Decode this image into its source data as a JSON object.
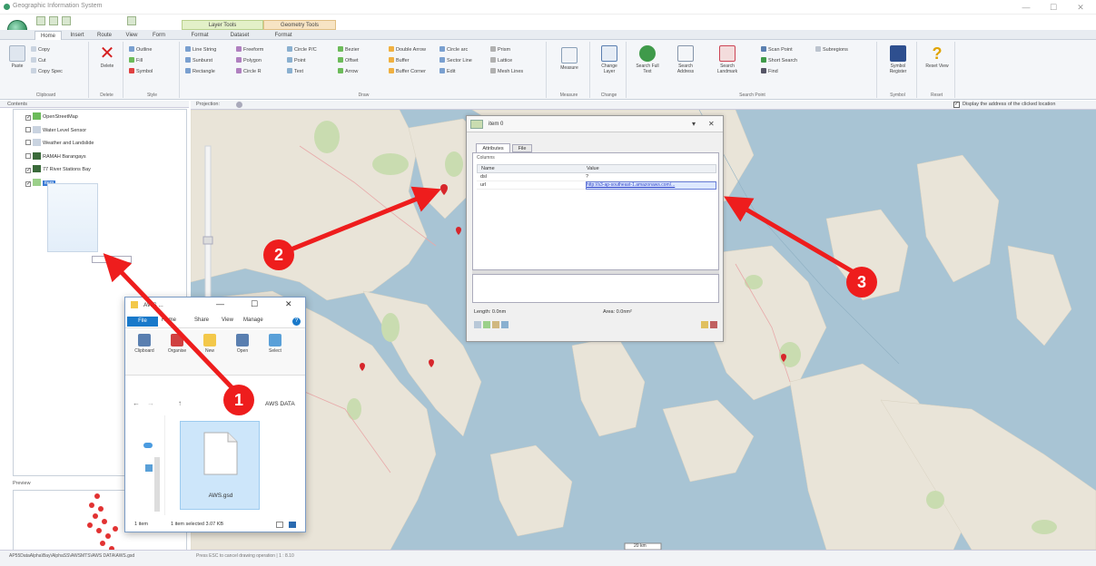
{
  "window": {
    "title": "Geographic Information System",
    "minimize_glyph": "—",
    "maximize_glyph": "☐",
    "close_glyph": "✕"
  },
  "context_tabs": [
    "Layer Tools",
    "Geometry Tools"
  ],
  "tabs": [
    "Home",
    "Insert",
    "Route",
    "View",
    "Form",
    "Format",
    "Dataset",
    "Format"
  ],
  "ribbon": {
    "clipboard": {
      "label": "Clipboard",
      "paste": "Paste",
      "copy": "Copy",
      "cut": "Cut",
      "copy_special": "Copy Spec"
    },
    "delete": {
      "label": "Delete",
      "button": "Delete"
    },
    "style": {
      "label": "Style",
      "outline": "Outline",
      "fill": "Fill",
      "symbol": "Symbol"
    },
    "draw": {
      "label": "Draw",
      "items": [
        "Line String",
        "Freeform",
        "Circle P/C",
        "Bezier",
        "Double Arrow",
        "Circle arc",
        "Prism",
        "Sunburst",
        "Polygon",
        "Point",
        "Offset",
        "Buffer",
        "Sector Line",
        "Lattice",
        "Rectangle",
        "Circle R",
        "Text",
        "Arrow",
        "Buffer Corner",
        "Edit",
        "Mesh Lines"
      ]
    },
    "measure": {
      "label": "Measure",
      "button": "Measure"
    },
    "change": {
      "label": "Change",
      "button": "Change Layer"
    },
    "search": {
      "label": "Search Point",
      "buttons": [
        "Search Full Text",
        "Search Address",
        "Search Landmark"
      ],
      "items": [
        "Scan Point",
        "Short Search",
        "Find",
        "Subregions"
      ]
    },
    "symbol": {
      "label": "Symbol",
      "button": "Symbol Register"
    },
    "reset": {
      "label": "Reset",
      "button": "Reset View"
    }
  },
  "contents": {
    "header": "Contents",
    "layers": [
      {
        "name": "OpenStreetMap",
        "checked": true
      },
      {
        "name": "Water Level Sensor",
        "checked": false
      },
      {
        "name": "Weather and Landslide",
        "checked": false
      },
      {
        "name": "RAMAH Barangays",
        "checked": false
      },
      {
        "name": "77 River Stations Bay",
        "checked": true
      },
      {
        "name": "item",
        "checked": true,
        "selected": true
      }
    ]
  },
  "map": {
    "projection_label": "Projection:",
    "address_checkbox": "Display the address of the clicked location",
    "scale_label": "20 km"
  },
  "dialog": {
    "title": "item 0",
    "tabs": [
      "Attributes",
      "File"
    ],
    "section": "Columns",
    "columns": [
      "Name",
      "Value"
    ],
    "rows": [
      {
        "name": "dsl",
        "value": "?"
      },
      {
        "name": "url",
        "value": "http://s3-ap-southeast-1.amazonaws.com/..."
      }
    ],
    "length": "Length: 0.0nm",
    "area": "Area: 0.0nm²"
  },
  "explorer": {
    "title": "AWS ...",
    "file_tab": "File",
    "tabs": [
      "Home",
      "Share",
      "View",
      "Manage"
    ],
    "groups": [
      "Clipboard",
      "Organise",
      "New",
      "Open",
      "Select"
    ],
    "path": "AWS DATA",
    "file_name": "AWS.gsd",
    "status_items": "1 item",
    "status_selected": "1 item selected  3.07 KB"
  },
  "callouts": [
    "1",
    "2",
    "3"
  ],
  "statusbar": {
    "path": "AP55DataAlpha\\Bay\\AlphaSS\\AWSMTS\\AWS DATA\\AWS.gsd",
    "text": "Press ESC to cancel drawing operation  |  1 : 8.10"
  },
  "preview": {
    "header": "Preview"
  },
  "colors": {
    "accent": "#2f8f5c",
    "arrow": "#ee1d1d",
    "map_water": "#a8c4d4",
    "map_land": "#e9e4d8"
  }
}
